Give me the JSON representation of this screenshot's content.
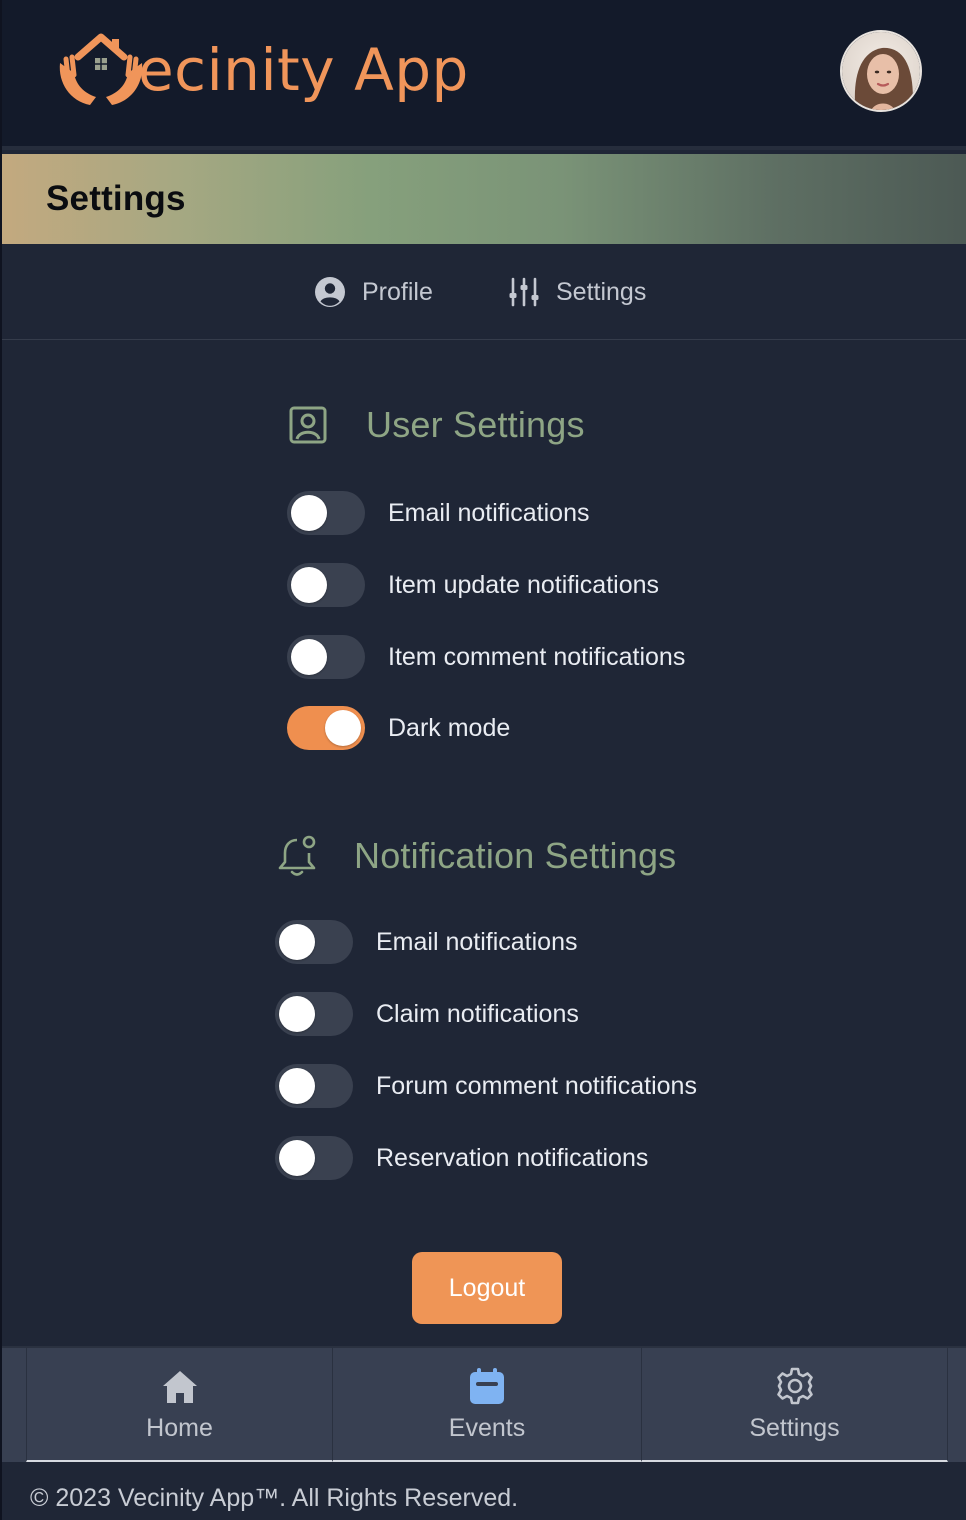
{
  "header": {
    "brand_name": "ecinity App",
    "brand_color": "#f0955a",
    "logo_icon": "house-in-hands-icon",
    "avatar_icon": "user-avatar"
  },
  "page": {
    "title": "Settings"
  },
  "tabs": [
    {
      "label": "Profile",
      "icon": "user-circle-icon"
    },
    {
      "label": "Settings",
      "icon": "sliders-icon"
    }
  ],
  "user_settings": {
    "title": "User Settings",
    "icon": "user-square-icon",
    "toggles": [
      {
        "label": "Email notifications",
        "on": false
      },
      {
        "label": "Item update notifications",
        "on": false
      },
      {
        "label": "Item comment notifications",
        "on": false
      },
      {
        "label": "Dark mode",
        "on": true
      }
    ]
  },
  "notification_settings": {
    "title": "Notification Settings",
    "icon": "bell-icon",
    "toggles": [
      {
        "label": "Email notifications",
        "on": false
      },
      {
        "label": "Claim notifications",
        "on": false
      },
      {
        "label": "Forum comment notifications",
        "on": false
      },
      {
        "label": "Reservation notifications",
        "on": false
      }
    ]
  },
  "logout_label": "Logout",
  "bottom_nav": [
    {
      "label": "Home",
      "icon": "home-icon"
    },
    {
      "label": "Events",
      "icon": "calendar-icon"
    },
    {
      "label": "Settings",
      "icon": "gear-icon"
    }
  ],
  "footer": {
    "copyright": "© 2023 Vecinity App™. All Rights Reserved."
  },
  "colors": {
    "accent": "#ef8f4f",
    "section_title": "#8ea585",
    "background": "#1f2636",
    "header_bg": "#131a2a"
  }
}
